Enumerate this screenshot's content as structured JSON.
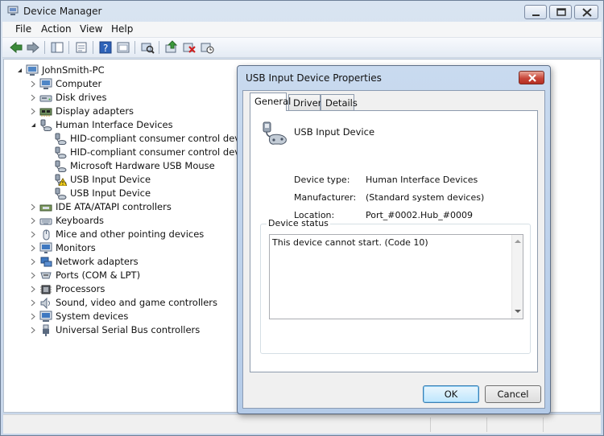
{
  "window": {
    "title": "Device Manager"
  },
  "menu": [
    {
      "label": "File"
    },
    {
      "label": "Action"
    },
    {
      "label": "View"
    },
    {
      "label": "Help"
    }
  ],
  "toolbar": {
    "icons": [
      "back-icon",
      "forward-icon",
      "console-tree-icon",
      "properties-icon",
      "help-icon",
      "console-icon",
      "scan-hardware-icon",
      "update-driver-icon",
      "disable-device-icon",
      "uninstall-device-icon"
    ]
  },
  "tree": {
    "root": "JohnSmith-PC",
    "items": [
      {
        "label": "Computer",
        "icon": "computer-icon",
        "expander": "collapsed"
      },
      {
        "label": "Disk drives",
        "icon": "disk-drive-icon",
        "expander": "collapsed"
      },
      {
        "label": "Display adapters",
        "icon": "display-adapter-icon",
        "expander": "collapsed"
      },
      {
        "label": "Human Interface Devices",
        "icon": "hid-icon",
        "expander": "expanded"
      },
      {
        "label": "HID-compliant consumer control device",
        "icon": "hid-icon",
        "child": true
      },
      {
        "label": "HID-compliant consumer control device",
        "icon": "hid-icon",
        "child": true
      },
      {
        "label": "Microsoft Hardware USB Mouse",
        "icon": "hid-icon",
        "child": true
      },
      {
        "label": "USB Input Device",
        "icon": "hid-warning-icon",
        "child": true
      },
      {
        "label": "USB Input Device",
        "icon": "hid-icon",
        "child": true
      },
      {
        "label": "IDE ATA/ATAPI controllers",
        "icon": "ide-controller-icon",
        "expander": "collapsed"
      },
      {
        "label": "Keyboards",
        "icon": "keyboard-icon",
        "expander": "collapsed"
      },
      {
        "label": "Mice and other pointing devices",
        "icon": "mouse-icon",
        "expander": "collapsed"
      },
      {
        "label": "Monitors",
        "icon": "monitor-icon",
        "expander": "collapsed"
      },
      {
        "label": "Network adapters",
        "icon": "network-adapter-icon",
        "expander": "collapsed"
      },
      {
        "label": "Ports (COM & LPT)",
        "icon": "port-icon",
        "expander": "collapsed"
      },
      {
        "label": "Processors",
        "icon": "processor-icon",
        "expander": "collapsed"
      },
      {
        "label": "Sound, video and game controllers",
        "icon": "sound-icon",
        "expander": "collapsed"
      },
      {
        "label": "System devices",
        "icon": "system-device-icon",
        "expander": "collapsed"
      },
      {
        "label": "Universal Serial Bus controllers",
        "icon": "usb-icon",
        "expander": "collapsed"
      }
    ]
  },
  "dialog": {
    "title": "USB Input Device Properties",
    "tabs": [
      {
        "label": "General",
        "active": true
      },
      {
        "label": "Driver"
      },
      {
        "label": "Details"
      }
    ],
    "device_name": "USB Input Device",
    "properties": [
      {
        "label": "Device type:",
        "value": "Human Interface Devices"
      },
      {
        "label": "Manufacturer:",
        "value": "(Standard system devices)"
      },
      {
        "label": "Location:",
        "value": "Port_#0002.Hub_#0009"
      }
    ],
    "status_group_label": "Device status",
    "status_text": "This device cannot start. (Code 10)",
    "ok_label": "OK",
    "cancel_label": "Cancel"
  },
  "colors": {
    "accent": "#3c7fb1",
    "close_red": "#c8473a"
  }
}
